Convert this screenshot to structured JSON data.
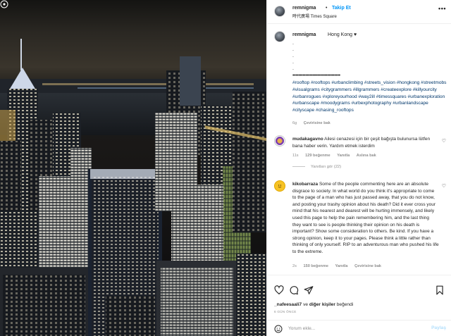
{
  "header": {
    "username": "remnigma",
    "separator": "•",
    "follow_label": "Takip Et",
    "location": "時代廣場 Times Square",
    "more_icon": "more-horizontal-icon"
  },
  "caption": {
    "username": "remnigma",
    "text": "Hong Kong ♥",
    "dots": [
      ".",
      ".",
      ".",
      ".",
      "."
    ],
    "dotline": "•••••••••••••••••••••••••••••••••",
    "hashtags": "#rooftop #rooftops #urbanclimbing #streets_vision #hongkong #streetmobs #visualgrams #citygrammers #illgrammers #createexplore #killyourcity #urbanrogues #xploreyourhood #way2ill #timessquares #urbanexploration #urbanscape #moodygrams #urbexphotography #urbanlandscape #cityscape #chasing_rooftops",
    "time": "6g",
    "translate": "Çevirisine bak"
  },
  "comments": [
    {
      "username": "mudakagavno",
      "text": "Ailesi cenazesi için bir çeşit bağışta bulunursa lütfen bana haber verin. Yardım etmek isterdim",
      "time": "11s",
      "likes": "129 beğenme",
      "reply": "Yanıtla",
      "translate": "Aslına bak",
      "replies": "Yanıtları gör (22)"
    },
    {
      "username": "kikobarraza",
      "text": "Some of the people commenting here are an absolute disgrace to society. In what world do you think it's appropriate to come to the page of a man who has just passed away, that you do not know, and posting your trashy opinion about his death? Did it ever cross your mind that his nearest and dearest will be hurting immensely, and likely used this page to help the pain remembering him, and the last thing they want to see is people thinking their opinion on his death is important? Show some consideration to others. Be kind. If you have a strong opinion, keep it to your pages. Please think a little rather than thinking of only yourself. RIP to an adventurous man who pushed his life to the extreme.",
      "time": "2s",
      "likes": "150 beğenme",
      "reply": "Yanıtla",
      "translate": "Çevirisine bak"
    }
  ],
  "actions": {
    "icons": [
      "heart-icon",
      "comment-icon",
      "share-icon",
      "bookmark-icon"
    ],
    "liked_by_user": "_nafeesaali7",
    "liked_by_mid": " ve ",
    "liked_by_others": "diğer kişiler",
    "liked_by_end": " beğendi",
    "ago": "6 GÜN ÖNCE"
  },
  "add_comment": {
    "placeholder": "Yorum ekle...",
    "post_label": "Paylaş"
  },
  "colors": {
    "accent": "#0095f6",
    "hashtag": "#00376b",
    "muted": "#8e8e8e"
  }
}
